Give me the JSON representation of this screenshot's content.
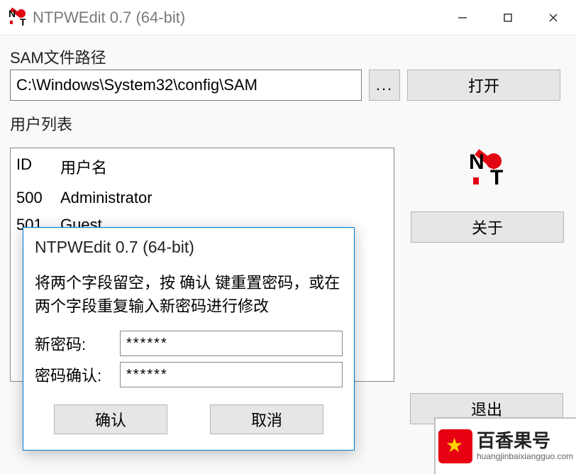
{
  "window": {
    "title": "NTPWEdit 0.7 (64-bit)"
  },
  "labels": {
    "sam_path": "SAM文件路径",
    "user_list": "用户列表",
    "open": "打开",
    "browse": "...",
    "about": "关于",
    "exit": "退出"
  },
  "path_value": "C:\\Windows\\System32\\config\\SAM",
  "columns": {
    "id": "ID",
    "username": "用户名"
  },
  "users": [
    {
      "id": "500",
      "name": "Administrator"
    },
    {
      "id": "501",
      "name": "Guest"
    }
  ],
  "dialog": {
    "title": "NTPWEdit 0.7 (64-bit)",
    "message": "将两个字段留空，按 确认 键重置密码，或在两个字段重复输入新密码进行修改",
    "new_pw_label": "新密码:",
    "confirm_pw_label": "密码确认:",
    "new_pw_value": "******",
    "confirm_pw_value": "******",
    "ok": "确认",
    "cancel": "取消"
  },
  "watermark": {
    "title": "百香果号",
    "url": "huangjinbaixiangguo.com"
  }
}
